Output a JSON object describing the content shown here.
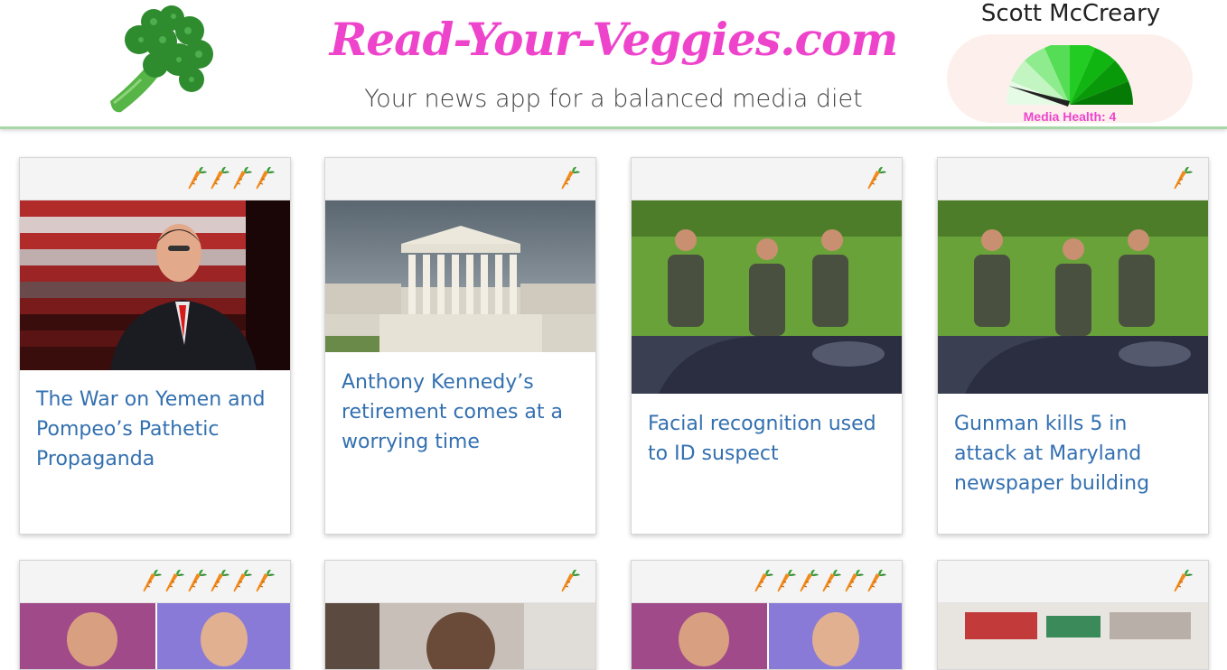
{
  "header": {
    "site_title": "Read-Your-Veggies.com",
    "tagline": "Your news app for a balanced media diet",
    "user_name": "Scott McCreary",
    "media_health_label": "Media Health: 4",
    "media_health_value": 4,
    "logo_icon": "broccoli-icon",
    "colors": {
      "title": "#ee44cc",
      "divider": "#a8d8a8",
      "gauge_bg": "#fdf0ec"
    }
  },
  "cards": [
    {
      "title": "The War on Yemen and Pompeo’s Pathetic Propaganda",
      "carrots": 4,
      "image": "politician-speaking-flag"
    },
    {
      "title": "Anthony Kennedy’s retirement comes at a worrying time",
      "carrots": 1,
      "image": "supreme-court-building"
    },
    {
      "title": "Facial recognition used to ID suspect",
      "carrots": 1,
      "image": "armed-officers"
    },
    {
      "title": "Gunman kills 5 in attack at Maryland newspaper building",
      "carrots": 1,
      "image": "armed-officers"
    },
    {
      "title": "",
      "carrots": 6,
      "image": "news-anchors"
    },
    {
      "title": "",
      "carrots": 1,
      "image": "person-photo"
    },
    {
      "title": "",
      "carrots": 6,
      "image": "news-anchors"
    },
    {
      "title": "",
      "carrots": 1,
      "image": "street-building"
    }
  ]
}
